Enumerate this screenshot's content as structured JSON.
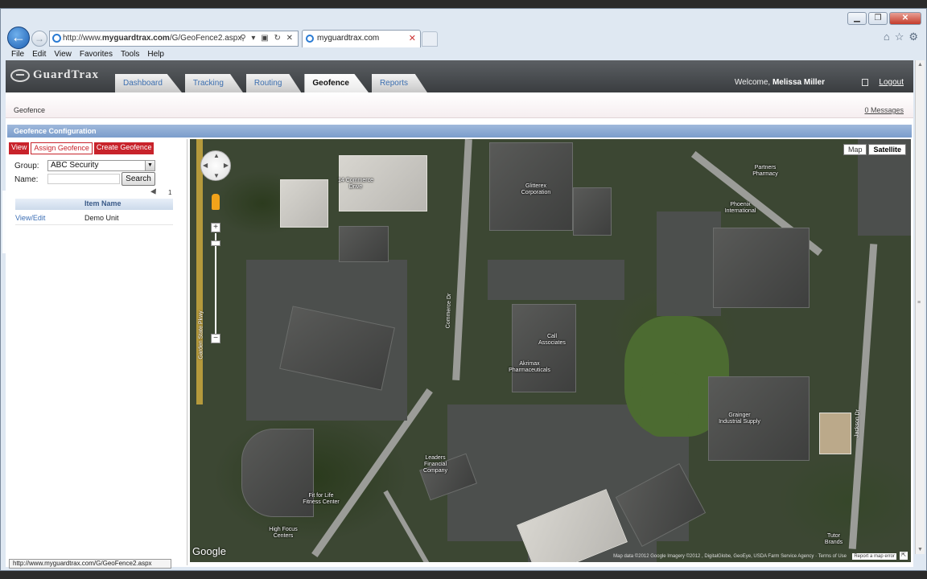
{
  "browser": {
    "url_prefix": "http://www.",
    "url_domain": "myguardtrax.com",
    "url_path": "/G/GeoFence2.aspx",
    "addr_tools": "⚲ ▾ ▣ ↻ ✕",
    "tab_title": "myguardtrax.com",
    "tab_close": "✕",
    "window_buttons": [
      "▁",
      "❐",
      "✕"
    ],
    "right_icons": [
      "⌂",
      "☆",
      "⚙"
    ],
    "back": "←",
    "forward": "→",
    "menu": [
      "File",
      "Edit",
      "View",
      "Favorites",
      "Tools",
      "Help"
    ],
    "status_url": "http://www.myguardtrax.com/G/GeoFence2.aspx"
  },
  "app": {
    "logo_text": "GuardTrax",
    "tabs": [
      "Dashboard",
      "Tracking",
      "Routing",
      "Geofence",
      "Reports"
    ],
    "active_tab": "Geofence",
    "welcome_label": "Welcome,",
    "user_name": "Melissa Miller",
    "logout": "Logout",
    "breadcrumb": "Geofence",
    "messages": "0 Messages",
    "section_title": "Geofence Configuration"
  },
  "panel": {
    "buttons": [
      "View",
      "Assign Geofence",
      "Create Geofence"
    ],
    "group_label": "Group:",
    "group_value": "ABC Security",
    "name_label": "Name:",
    "name_value": "",
    "search_label": "Search",
    "pager": "1",
    "column_header": "Item Name",
    "rows": [
      {
        "action": "View/Edit",
        "name": "Demo Unit"
      }
    ]
  },
  "map": {
    "type_buttons": [
      "Map",
      "Satellite"
    ],
    "active_type": "Satellite",
    "zoom_in": "+",
    "zoom_out": "−",
    "google": "Google",
    "attribution": "Map data ©2012 Google Imagery ©2012 , DigitalGlobe, GeoEye, USDA Farm Service Agency · Terms of Use",
    "report": "Report a map error",
    "labels": {
      "commerce_park": "14 Commerce\nDrive",
      "glitterex": "Glitterex\nCorporation",
      "partners": "Partners\nPharmacy",
      "phoenix": "Phoenix\nInternational",
      "call_associates": "Call\nAssociates",
      "akrimax": "Akrimax\nPharmaceuticals",
      "grainger": "Grainger\nIndustrial Supply",
      "leaders": "Leaders\nFinancial\nCompany",
      "fit_for_life": "Fit for Life\nFitness Center",
      "high_focus": "High Focus\nCenters",
      "tutor": "Tutor\nBrands",
      "garden_state": "Garden State Pkwy",
      "commerce_dr": "Commerce Dr",
      "jackson_dr": "Jackson Dr"
    }
  }
}
